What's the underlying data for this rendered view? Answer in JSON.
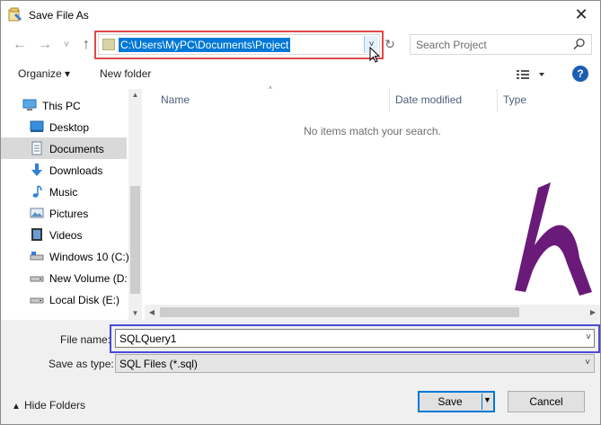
{
  "window": {
    "title": "Save File As",
    "close_glyph": "✕"
  },
  "nav": {
    "back_glyph": "←",
    "forward_glyph": "→",
    "recent_glyph": "˅",
    "up_glyph": "↑",
    "address": "C:\\Users\\MyPC\\Documents\\Project",
    "address_dropdown_glyph": "˅",
    "refresh_glyph": "↻",
    "search_placeholder": "Search Project"
  },
  "toolbar": {
    "organize": "Organize ▾",
    "new_folder": "New folder",
    "help": "?"
  },
  "sidebar": {
    "items": [
      {
        "label": "This PC",
        "icon": "pc-icon"
      },
      {
        "label": "Desktop",
        "icon": "desktop-icon"
      },
      {
        "label": "Documents",
        "icon": "documents-icon",
        "selected": true
      },
      {
        "label": "Downloads",
        "icon": "downloads-icon"
      },
      {
        "label": "Music",
        "icon": "music-icon"
      },
      {
        "label": "Pictures",
        "icon": "pictures-icon"
      },
      {
        "label": "Videos",
        "icon": "videos-icon"
      },
      {
        "label": "Windows 10 (C:)",
        "icon": "drive-icon"
      },
      {
        "label": "New Volume (D:",
        "icon": "drive-icon"
      },
      {
        "label": "Local Disk (E:)",
        "icon": "drive-icon"
      }
    ]
  },
  "content": {
    "columns": [
      "Name",
      "Date modified",
      "Type"
    ],
    "empty_message": "No items match your search."
  },
  "form": {
    "file_name_label": "File name:",
    "file_name_value": "SQLQuery1",
    "save_as_type_label": "Save as type:",
    "save_as_type_value": "SQL Files (*.sql)"
  },
  "footer": {
    "hide_folders": "Hide Folders",
    "save": "Save",
    "cancel": "Cancel"
  },
  "colors": {
    "accent": "#0078d7",
    "address_highlight": "#e3474a",
    "filename_highlight": "#4a4ad8",
    "logo": "#6a1b7a"
  }
}
